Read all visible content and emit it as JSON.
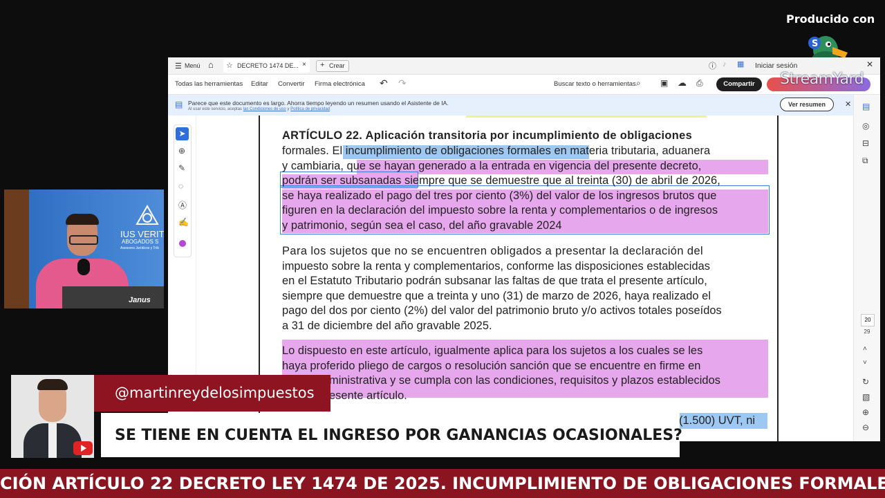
{
  "overlay": {
    "producido_label": "Producido con",
    "streamyard_label": "StreamYard"
  },
  "app": {
    "menu_label": "Menú",
    "tab_title": "DECRETO 1474 DE...",
    "new_tab_label": "Crear",
    "signin_label": "Iniciar sesión",
    "toolbar": {
      "all_tools": "Todas las herramientas",
      "edit": "Editar",
      "convert": "Convertir",
      "esign": "Firma electrónica",
      "search": "Buscar texto o herramientas",
      "share": "Compartir"
    },
    "ai_banner": {
      "message": "Parece que este documento es largo. Ahorra tiempo leyendo un resumen usando el Asistente de IA.",
      "sub_prefix": "Al usar este servicio, aceptas",
      "terms_link": "las Condiciones de uso",
      "sub_join": "y",
      "privacy_link": "Política de privacidad",
      "button": "Ver resumen"
    },
    "page_numbers": [
      "20",
      "29"
    ]
  },
  "document": {
    "lines": [
      "ARTÍCULO 22. Aplicación transitoria por incumplimiento de obligaciones",
      "formales. El incumplimiento de obligaciones formales en materia tributaria, aduanera",
      "y cambiaria, que se hayan generado a la entrada en vigencia del presente decreto,",
      "podrán ser subsanadas siempre que se demuestre que al treinta (30) de abril de 2026,",
      "se haya realizado el pago del tres por ciento (3%) del valor de los ingresos brutos que",
      "figuren en la declaración del impuesto sobre la renta y complementarios o de ingresos",
      "y patrimonio, según sea el caso, del año gravable 2024",
      "Para los sujetos que no se encuentren obligados a presentar la declaración del",
      "impuesto sobre la renta y complementarios, conforme las disposiciones establecidas",
      "en el Estatuto Tributario podrán subsanar las faltas de que trata el presente artículo,",
      "siempre que demuestre que a treinta y uno (31) de marzo de 2026, haya realizado el",
      "pago del dos por ciento (2%) del valor del patrimonio bruto y/o activos totales poseídos",
      "a 31 de diciembre del año gravable 2025.",
      "Lo dispuesto en este artículo, igualmente aplica para los sujetos a los cuales se les",
      "haya proferido pliego de cargos o resolución sanción que se encuentre en firme en",
      "ministrativa y se cumpla con las condiciones, requisitos y plazos establecidos",
      "esente artículo.",
      "(1.500) UVT, ni"
    ]
  },
  "webcam": {
    "logo_line1": "IUS VERITA",
    "logo_line2": "ABOGADOS S",
    "logo_line3": "Asesores Jurídicos y Trib",
    "mic_brand": "Janus"
  },
  "lower_third": {
    "handle": "@martinreydelosimpuestos",
    "question": "SE TIENE EN CUENTA EL INGRESO POR GANANCIAS OCASIONALES?"
  },
  "ticker": {
    "text": "CIÓN ARTÍCULO 22 DECRETO LEY 1474 DE 2025. INCUMPLIMIENTO DE OBLIGACIONES FORMALES ."
  },
  "colors": {
    "ticker_bg": "#8a1520",
    "handle_bg": "#8d1420",
    "highlight_magenta": "#e7a7ec",
    "highlight_blue": "#9cc8f2",
    "share_button": "#1f1f1f",
    "streamyard_button": "#e8504a"
  }
}
